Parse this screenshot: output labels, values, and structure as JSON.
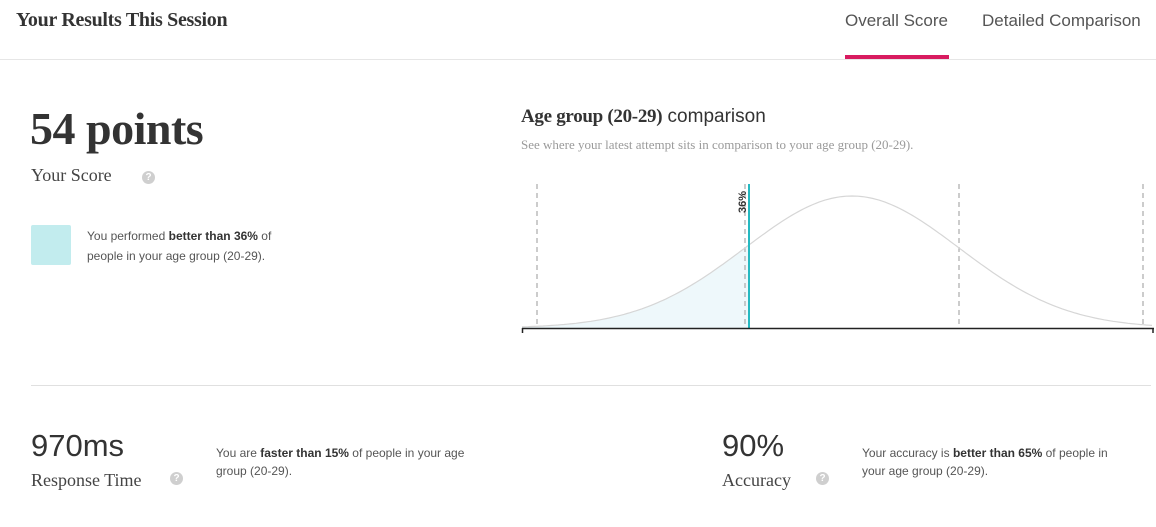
{
  "header": {
    "title": "Your Results This Session",
    "tabs": [
      {
        "label": "Overall Score",
        "active": true
      },
      {
        "label": "Detailed Comparison",
        "active": false
      }
    ],
    "accent_color": "#d81b60"
  },
  "score": {
    "value": "54 points",
    "label": "Your Score",
    "help_icon": "question-circle-icon",
    "percentile_text": {
      "prefix": "You performed ",
      "emphasis": "better than 36%",
      "suffix": " of people in your age group (20-29)."
    },
    "swatch_color": "#c2ecee"
  },
  "comparison": {
    "title_strong": "Age group (20-29)",
    "title_rest": " comparison",
    "subtitle": "See where your latest attempt sits in comparison to your age group (20-29).",
    "marker_label": "36%",
    "marker_percentile": 36,
    "marker_color": "#26b9c1",
    "curve_color": "#d6d6d6",
    "fill_color": "#eef8fb"
  },
  "metrics": {
    "response_time": {
      "value": "970ms",
      "label": "Response Time",
      "help_icon": "question-circle-icon",
      "text_prefix": "You are ",
      "text_emphasis": "faster than 15%",
      "text_suffix": " of people in your age group (20-29)."
    },
    "accuracy": {
      "value": "90%",
      "label": "Accuracy",
      "help_icon": "question-circle-icon",
      "text_prefix": "Your accuracy is ",
      "text_emphasis": "better than 65%",
      "text_suffix": " of people in your age group (20-29)."
    }
  }
}
